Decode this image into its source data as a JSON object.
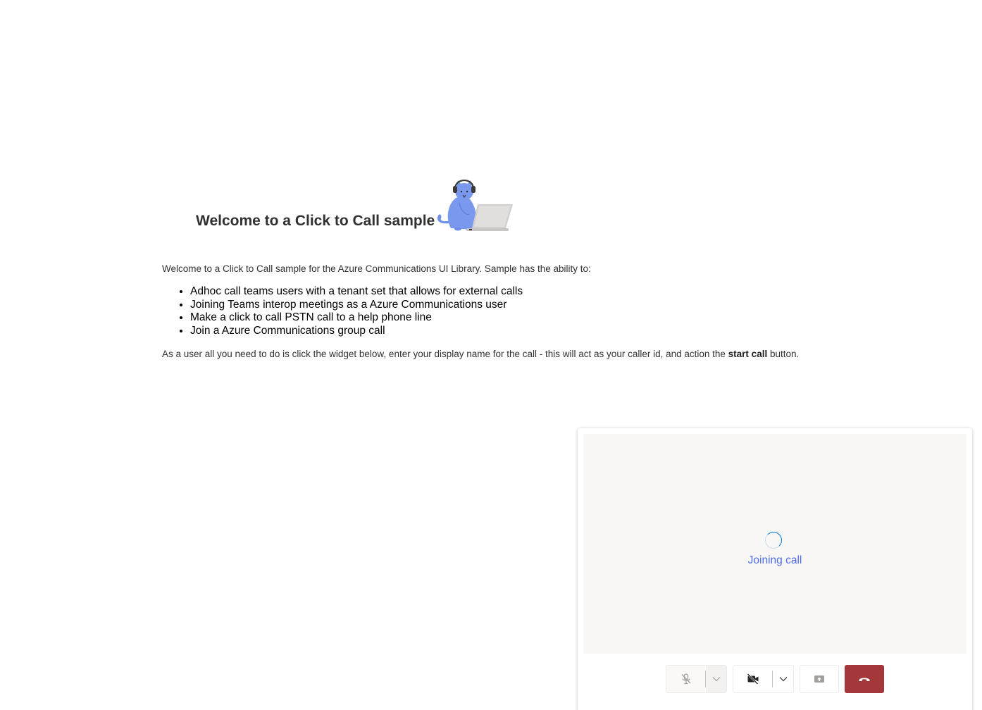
{
  "hero": {
    "title": "Welcome to a Click to Call sample",
    "illustration_icon": "cat-with-headphones-laptop-illustration"
  },
  "intro": {
    "text": "Welcome to a Click to Call sample for the Azure Communications UI Library. Sample has the ability to:"
  },
  "features": [
    "Adhoc call teams users with a tenant set that allows for external calls",
    "Joining Teams interop meetings as a Azure Communications user",
    "Make a click to call PSTN call to a help phone line",
    "Join a Azure Communications group call"
  ],
  "instructions": {
    "before": "As a user all you need to do is click the widget below, enter your display name for the call - this will act as your caller id, and action the ",
    "bold": "start call",
    "after": " button."
  },
  "widget": {
    "status_text": "Joining call",
    "controls": {
      "microphone": {
        "icon": "mic-off-icon",
        "menu_icon": "chevron-down-icon",
        "disabled": true
      },
      "camera": {
        "icon": "video-off-icon",
        "menu_icon": "chevron-down-icon"
      },
      "share": {
        "icon": "share-screen-icon",
        "disabled": true
      },
      "end_call": {
        "icon": "hang-up-icon"
      }
    }
  },
  "colors": {
    "accent": "#4f6bed",
    "end_call": "#a4373a",
    "stage_background": "#f8f7f5"
  }
}
